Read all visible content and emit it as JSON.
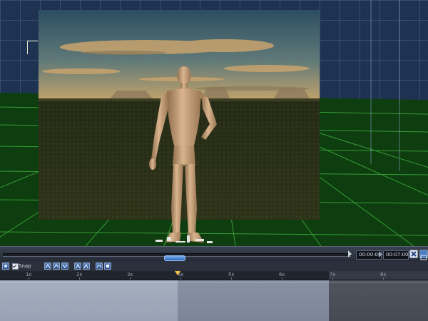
{
  "viewport": {
    "colors": {
      "backdrop": "#1e3352",
      "grid_wall": "#5a6f96",
      "floor": "#0e3d0f",
      "floor_grid": "#3fae3c",
      "sky_top": "#2e4f62",
      "sky_horizon": "#c8a56a",
      "ground": "#2a2e17"
    },
    "figure_icon": "human-figure",
    "ground_prop_icon": "scattered-objects"
  },
  "playback": {
    "current_time": "00:00:00",
    "end_time": "00:07:00",
    "progress": 0.47,
    "expand_icon": "close-x-icon",
    "panel_icon": "panel-toggle-icon"
  },
  "timeline_toolbar": {
    "snap_label": "Snap",
    "snap_checked": true,
    "left_icon": "track-mode-icon",
    "tool_icons": [
      "key-add-icon",
      "key-up-icon",
      "key-down-icon",
      "key-prev-icon",
      "key-next-icon",
      "curve-icon",
      "copy-icon"
    ]
  },
  "timeline": {
    "ruler_labels": [
      "1s",
      "2s",
      "3s",
      "4s",
      "5s",
      "6s",
      "7s",
      "8s"
    ],
    "playhead_position_seconds": 3.9,
    "range_end_seconds": 7,
    "colors": {
      "elapsed": "#a4aebf",
      "remaining": "#8791a3",
      "outside_range": "#4f545d"
    }
  }
}
